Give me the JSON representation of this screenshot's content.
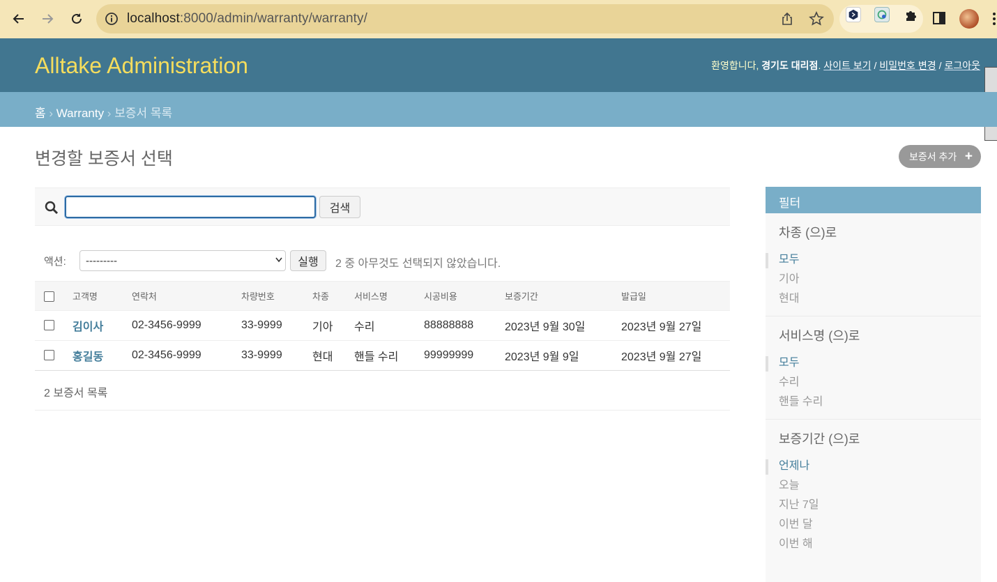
{
  "browser": {
    "url_host": "localhost",
    "url_rest": ":8000/admin/warranty/warranty/"
  },
  "header": {
    "site_name": "Alltake Administration",
    "welcome": "환영합니다,",
    "username": "경기도 대리점",
    "view_site": "사이트 보기",
    "change_password": "비밀번호 변경",
    "logout": "로그아웃"
  },
  "breadcrumbs": {
    "home": "홈",
    "app": "Warranty",
    "current": "보증서 목록"
  },
  "page": {
    "title": "변경할 보증서 선택",
    "add_label": "보증서 추가"
  },
  "search": {
    "value": "",
    "button": "검색"
  },
  "actions": {
    "label": "액션:",
    "selected_option": "---------",
    "run_button": "실행",
    "counter": "2 중 아무것도 선택되지 않았습니다."
  },
  "table": {
    "columns": [
      "고객명",
      "연락처",
      "차량번호",
      "차종",
      "서비스명",
      "시공비용",
      "보증기간",
      "발급일"
    ],
    "rows": [
      [
        "김이사",
        "02-3456-9999",
        "33-9999",
        "기아",
        "수리",
        "88888888",
        "2023년 9월 30일",
        "2023년 9월 27일"
      ],
      [
        "홍길동",
        "02-3456-9999",
        "33-9999",
        "현대",
        "핸들 수리",
        "99999999",
        "2023년 9월 9일",
        "2023년 9월 27일"
      ]
    ]
  },
  "paginator": "2 보증서 목록",
  "filter": {
    "title": "필터",
    "sections": [
      {
        "title": "차종 (으)로",
        "items": [
          "모두",
          "기아",
          "현대"
        ]
      },
      {
        "title": "서비스명 (으)로",
        "items": [
          "모두",
          "수리",
          "핸들 수리"
        ]
      },
      {
        "title": "보증기간 (으)로",
        "items": [
          "언제나",
          "오늘",
          "지난 7일",
          "이번 달",
          "이번 해"
        ]
      }
    ]
  },
  "colors": {
    "header_bg": "#417690",
    "breadcrumb_bg": "#79aec8",
    "brand_text": "#f5dd5d",
    "link": "#447e9b"
  }
}
